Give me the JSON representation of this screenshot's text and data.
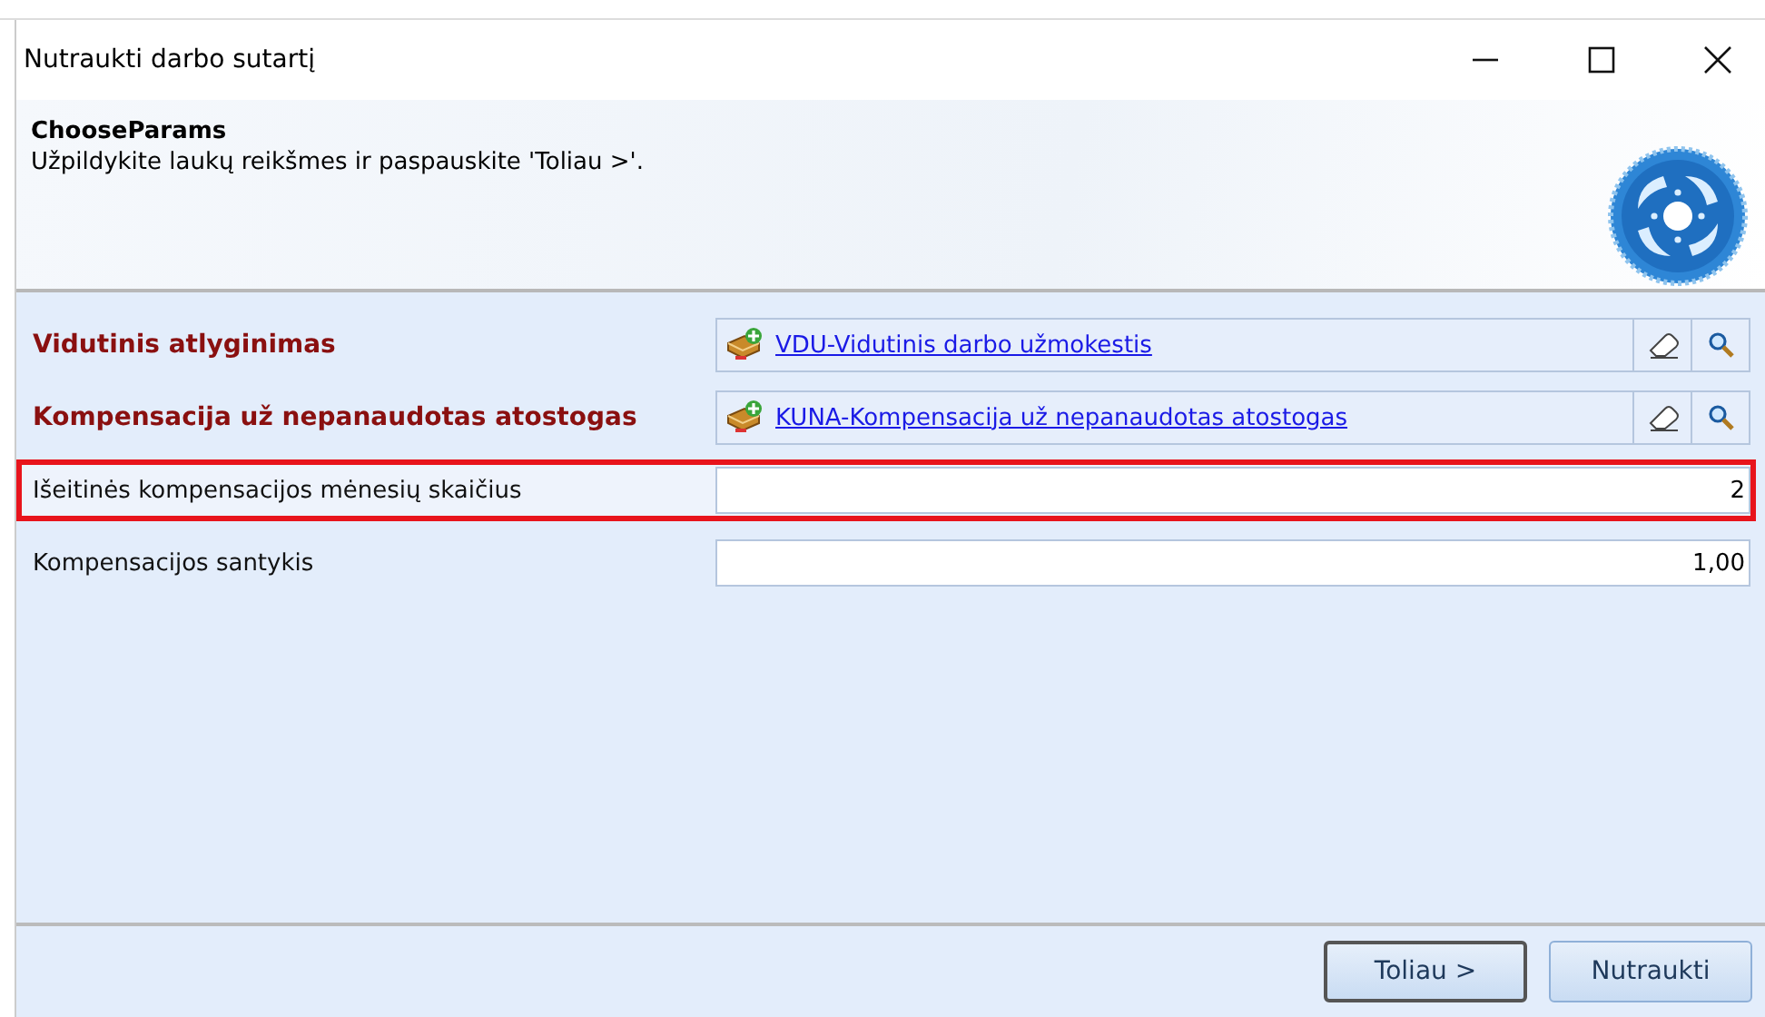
{
  "window": {
    "title": "Nutraukti darbo sutartį"
  },
  "header": {
    "title": "ChooseParams",
    "subtitle": "Užpildykite laukų reikšmes ir paspauskite 'Toliau >'."
  },
  "fields": [
    {
      "kind": "lookup",
      "label": "Vidutinis atlyginimas",
      "required": true,
      "highlighted": false,
      "value": "VDU-Vidutinis darbo užmokestis"
    },
    {
      "kind": "lookup",
      "label": "Kompensacija už nepanaudotas atostogas",
      "required": true,
      "highlighted": false,
      "value": "KUNA-Kompensacija už nepanaudotas atostogas"
    },
    {
      "kind": "number",
      "label": "Išeitinės kompensacijos mėnesių skaičius",
      "required": false,
      "highlighted": true,
      "value": "2"
    },
    {
      "kind": "number",
      "label": "Kompensacijos santykis",
      "required": false,
      "highlighted": false,
      "value": "1,00"
    }
  ],
  "buttons": [
    {
      "label": "Toliau >",
      "default": true
    },
    {
      "label": "Nutraukti",
      "default": false
    }
  ]
}
